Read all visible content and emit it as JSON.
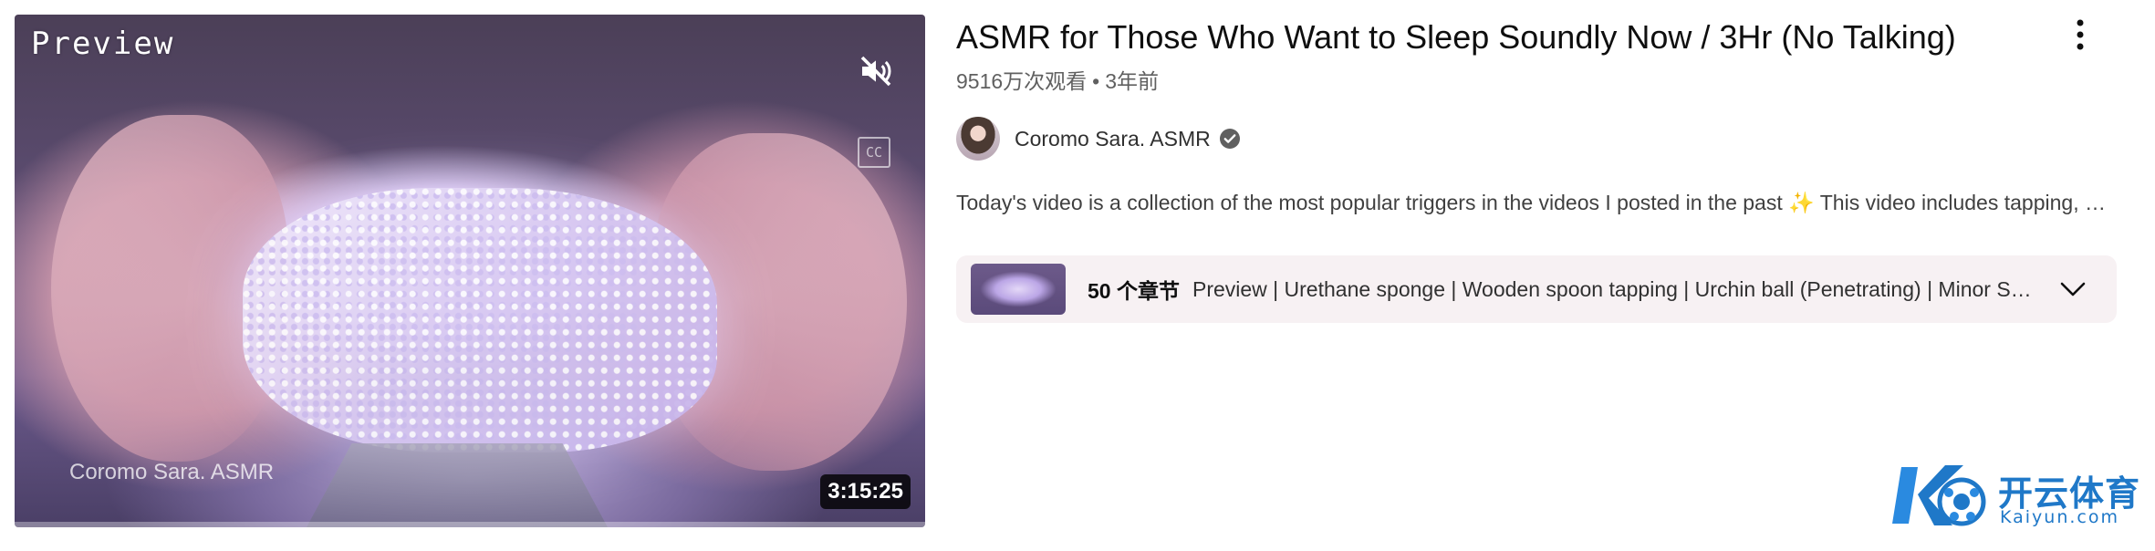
{
  "video": {
    "title": "ASMR for Those Who Want to Sleep Soundly Now / 3Hr (No Talking)",
    "views": "9516万次观看",
    "separator": "•",
    "age": "3年前",
    "description": "Today's video is a collection of the most popular triggers in the videos I posted in the past ✨ This video includes tapping, scratching and many other relaxing sounds for you to fall asleep soundly.",
    "progress_fraction": 0.0
  },
  "thumbnail": {
    "preview_label": "Preview",
    "watermark_channel": "Coromo Sara. ASMR",
    "duration": "3:15:25",
    "cc_label": "CC",
    "mute_icon": "volume-off-icon"
  },
  "channel": {
    "name": "Coromo Sara. ASMR",
    "verified_icon": "verified-check-icon"
  },
  "chapters": {
    "count_label": "50 个章节",
    "list": "Preview | Urethane sponge | Wooden spoon tapping | Urchin ball (Penetrating) | Minor Sounds | Ear cleaning | Gel sounds",
    "expand_icon": "chevron-down-icon"
  },
  "logo": {
    "text_cn": "开云体育",
    "text_en": "Kaiyun.com"
  },
  "colors": {
    "title": "#0f0f0f",
    "meta": "#606060",
    "chapter_bg": "#f7f1f3",
    "logo_blue": "#1f78c8"
  }
}
